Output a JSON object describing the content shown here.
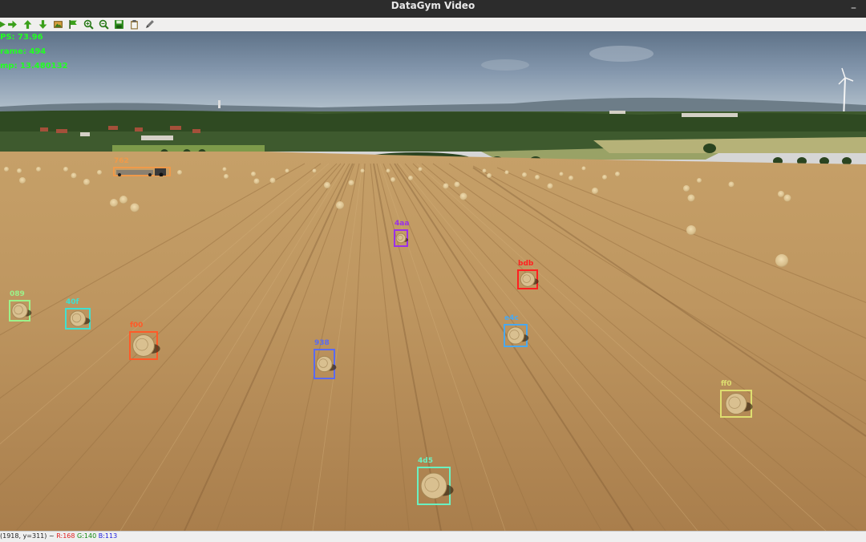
{
  "window": {
    "title": "DataGym Video",
    "minimize_glyph": "–"
  },
  "toolbar": {
    "icons": [
      "play-icon",
      "forward-arrow-icon",
      "up-arrow-icon",
      "down-arrow-icon",
      "image-icon",
      "flag-icon",
      "zoom-in-icon",
      "zoom-out-icon",
      "save-icon",
      "clipboard-icon",
      "edit-icon"
    ]
  },
  "overlay": {
    "fps": "PS: 73.96",
    "frame": "rame: 494",
    "timestamp": "mp: 13.480132",
    "color": "#22ff22"
  },
  "detections": [
    {
      "id": "762",
      "color": "#f09a4a"
    },
    {
      "id": "4aa",
      "color": "#9b30e8"
    },
    {
      "id": "bdb",
      "color": "#ff2020"
    },
    {
      "id": "089",
      "color": "#9cf28a"
    },
    {
      "id": "40f",
      "color": "#40e0d0"
    },
    {
      "id": "f00",
      "color": "#ff5a28"
    },
    {
      "id": "938",
      "color": "#5a6af0"
    },
    {
      "id": "e4c",
      "color": "#4aa8ee"
    },
    {
      "id": "ff0",
      "color": "#dede70"
    },
    {
      "id": "4d5",
      "color": "#6af0c0"
    }
  ],
  "status": {
    "coords": "(1918, y=311) ~",
    "r": "R:168",
    "g": "G:140",
    "b": "B:113",
    "r_color": "#e02020",
    "g_color": "#108a10",
    "b_color": "#2020e0"
  }
}
